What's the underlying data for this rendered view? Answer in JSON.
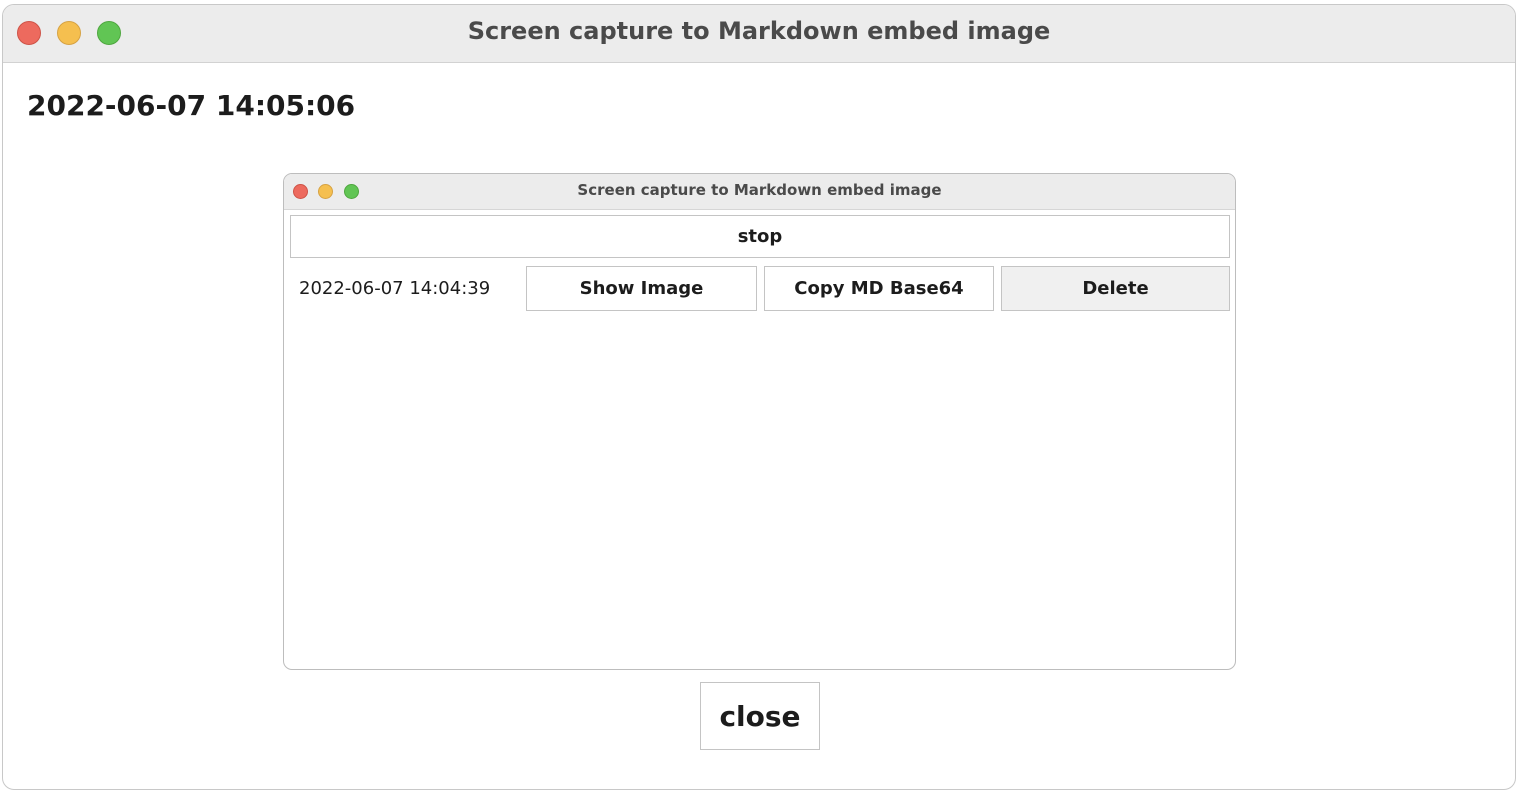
{
  "window": {
    "title": "Screen capture to Markdown embed image",
    "clock": "2022-06-07 14:05:06",
    "close_label": "close"
  },
  "inner_window": {
    "title": "Screen capture to Markdown embed image",
    "stop_label": "stop",
    "captures": [
      {
        "timestamp": "2022-06-07 14:04:39",
        "show_label": "Show Image",
        "copy_label": "Copy MD Base64",
        "delete_label": "Delete"
      }
    ]
  },
  "colors": {
    "close_light": "#ed6a5e",
    "minimize_light": "#f5bf4f",
    "zoom_light": "#61c554",
    "titlebar": "#ececec"
  }
}
